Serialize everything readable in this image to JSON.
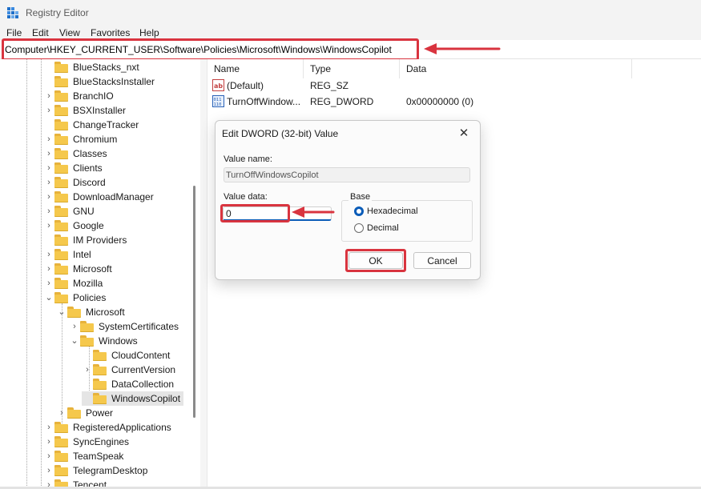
{
  "window": {
    "title": "Registry Editor"
  },
  "menu": [
    "File",
    "Edit",
    "View",
    "Favorites",
    "Help"
  ],
  "address": "Computer\\HKEY_CURRENT_USER\\Software\\Policies\\Microsoft\\Windows\\WindowsCopilot",
  "tree": [
    {
      "label": "BlueStacks_nxt",
      "level": 0,
      "expander": ""
    },
    {
      "label": "BlueStacksInstaller",
      "level": 0,
      "expander": ""
    },
    {
      "label": "BranchIO",
      "level": 0,
      "expander": "collapsed"
    },
    {
      "label": "BSXInstaller",
      "level": 0,
      "expander": "collapsed"
    },
    {
      "label": "ChangeTracker",
      "level": 0,
      "expander": ""
    },
    {
      "label": "Chromium",
      "level": 0,
      "expander": "collapsed"
    },
    {
      "label": "Classes",
      "level": 0,
      "expander": "collapsed"
    },
    {
      "label": "Clients",
      "level": 0,
      "expander": "collapsed"
    },
    {
      "label": "Discord",
      "level": 0,
      "expander": "collapsed"
    },
    {
      "label": "DownloadManager",
      "level": 0,
      "expander": "collapsed"
    },
    {
      "label": "GNU",
      "level": 0,
      "expander": "collapsed"
    },
    {
      "label": "Google",
      "level": 0,
      "expander": "collapsed"
    },
    {
      "label": "IM Providers",
      "level": 0,
      "expander": ""
    },
    {
      "label": "Intel",
      "level": 0,
      "expander": "collapsed"
    },
    {
      "label": "Microsoft",
      "level": 0,
      "expander": "collapsed"
    },
    {
      "label": "Mozilla",
      "level": 0,
      "expander": "collapsed"
    },
    {
      "label": "Policies",
      "level": 0,
      "expander": "expanded"
    },
    {
      "label": "Microsoft",
      "level": 1,
      "expander": "expanded"
    },
    {
      "label": "SystemCertificates",
      "level": 2,
      "expander": "collapsed"
    },
    {
      "label": "Windows",
      "level": 2,
      "expander": "expanded"
    },
    {
      "label": "CloudContent",
      "level": 3,
      "expander": ""
    },
    {
      "label": "CurrentVersion",
      "level": 3,
      "expander": "collapsed"
    },
    {
      "label": "DataCollection",
      "level": 3,
      "expander": ""
    },
    {
      "label": "WindowsCopilot",
      "level": 3,
      "expander": "",
      "selected": true
    },
    {
      "label": "Power",
      "level": 1,
      "expander": "collapsed"
    },
    {
      "label": "RegisteredApplications",
      "level": 0,
      "expander": "collapsed"
    },
    {
      "label": "SyncEngines",
      "level": 0,
      "expander": "collapsed"
    },
    {
      "label": "TeamSpeak",
      "level": 0,
      "expander": "collapsed"
    },
    {
      "label": "TelegramDesktop",
      "level": 0,
      "expander": "collapsed"
    },
    {
      "label": "Tencent",
      "level": 0,
      "expander": "collapsed"
    }
  ],
  "columns": {
    "name": "Name",
    "type": "Type",
    "data": "Data"
  },
  "values": [
    {
      "name": "(Default)",
      "type": "REG_SZ",
      "data": "",
      "icon": "string-value-icon"
    },
    {
      "name": "TurnOffWindow...",
      "type": "REG_DWORD",
      "data": "0x00000000 (0)",
      "icon": "binary-value-icon"
    }
  ],
  "dialog": {
    "title": "Edit DWORD (32-bit) Value",
    "value_name_label": "Value name:",
    "value_name": "TurnOffWindowsCopilot",
    "value_data_label": "Value data:",
    "value_data": "0",
    "base_label": "Base",
    "hex_label": "Hexadecimal",
    "dec_label": "Decimal",
    "selected_base": "Hexadecimal",
    "ok": "OK",
    "cancel": "Cancel",
    "close_glyph": "✕"
  },
  "colors": {
    "highlight": "#d9343f",
    "accent": "#0a5cb8",
    "folder": "#f5c84c"
  }
}
